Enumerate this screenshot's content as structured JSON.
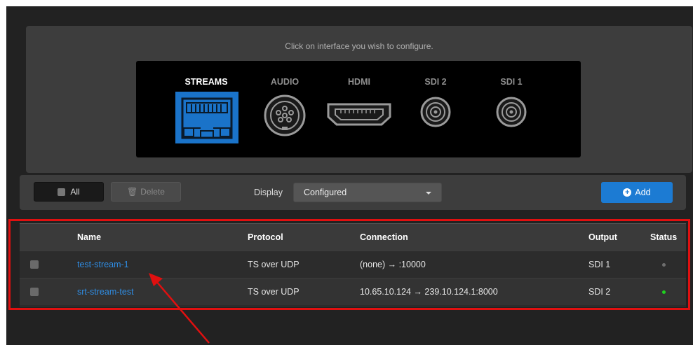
{
  "interface_panel": {
    "hint": "Click on interface you wish to configure.",
    "interfaces": [
      {
        "label": "STREAMS",
        "icon": "ethernet-port-icon",
        "active": true
      },
      {
        "label": "AUDIO",
        "icon": "audio-connector-icon",
        "active": false
      },
      {
        "label": "HDMI",
        "icon": "hdmi-port-icon",
        "active": false
      },
      {
        "label": "SDI 2",
        "icon": "bnc-connector-icon",
        "active": false
      },
      {
        "label": "SDI 1",
        "icon": "bnc-connector-icon",
        "active": false
      }
    ]
  },
  "toolbar": {
    "all_label": "All",
    "delete_label": "Delete",
    "display_label": "Display",
    "display_value": "Configured",
    "add_label": "Add"
  },
  "table": {
    "columns": [
      "Name",
      "Protocol",
      "Connection",
      "Output",
      "Status"
    ],
    "rows": [
      {
        "name": "test-stream-1",
        "protocol": "TS over UDP",
        "connection": "(none) → :10000",
        "output": "SDI 1",
        "status": "inactive"
      },
      {
        "name": "srt-stream-test",
        "protocol": "TS over UDP",
        "connection": "10.65.10.124 → 239.10.124.1:8000",
        "output": "SDI 2",
        "status": "active"
      }
    ]
  },
  "colors": {
    "accent": "#1c7bd3",
    "link": "#2f8de4",
    "status_active": "#1fd11f",
    "status_inactive": "#6e6e6e",
    "annotation": "#e01010"
  }
}
